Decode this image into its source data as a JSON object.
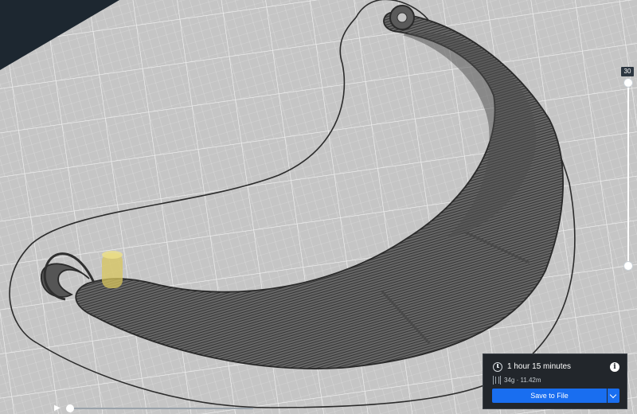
{
  "layer_view": {
    "current_layer": "30"
  },
  "print_info": {
    "time": "1 hour 15 minutes",
    "material": "34g · 11.42m",
    "save_label": "Save to File"
  },
  "icons": {
    "clock": "clock-icon",
    "info": "info-icon",
    "spool": "spool-icon",
    "play": "play-icon",
    "chevron": "chevron-down-icon"
  },
  "colors": {
    "background": "#1d2730",
    "build_plate": "#c4c4c4",
    "grid": "#ececec",
    "model": "#585858",
    "nozzle": "#d8c65e",
    "accent": "#196ef0"
  }
}
